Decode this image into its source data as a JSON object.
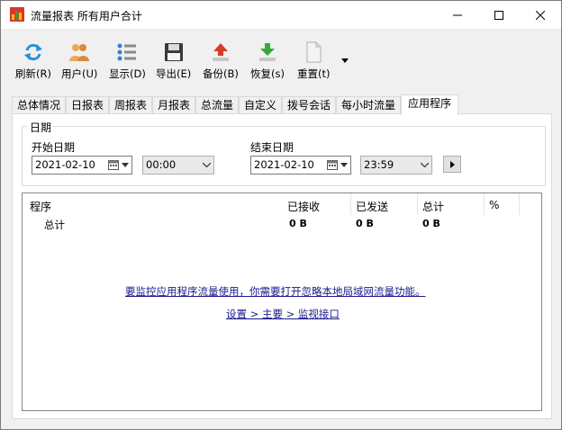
{
  "window": {
    "title": "流量报表 所有用户合计"
  },
  "toolbar": {
    "buttons": [
      {
        "label": "刷新(R)",
        "icon": "refresh-icon"
      },
      {
        "label": "用户(U)",
        "icon": "users-icon"
      },
      {
        "label": "显示(D)",
        "icon": "display-icon"
      },
      {
        "label": "导出(E)",
        "icon": "save-icon"
      },
      {
        "label": "备份(B)",
        "icon": "backup-icon"
      },
      {
        "label": "恢复(s)",
        "icon": "restore-icon"
      },
      {
        "label": "重置(t)",
        "icon": "reset-icon"
      }
    ]
  },
  "tabs": [
    {
      "label": "总体情况",
      "active": false
    },
    {
      "label": "日报表",
      "active": false
    },
    {
      "label": "周报表",
      "active": false
    },
    {
      "label": "月报表",
      "active": false
    },
    {
      "label": "总流量",
      "active": false
    },
    {
      "label": "自定义",
      "active": false
    },
    {
      "label": "拨号会话",
      "active": false
    },
    {
      "label": "每小时流量",
      "active": false
    },
    {
      "label": "应用程序",
      "active": true
    }
  ],
  "date_group": {
    "title": "日期",
    "start_label": "开始日期",
    "start_date": "2021-02-10",
    "start_time": "00:00",
    "end_label": "结束日期",
    "end_date": "2021-02-10",
    "end_time": "23:59"
  },
  "table": {
    "columns": [
      "程序",
      "已接收",
      "已发送",
      "总计",
      "%"
    ],
    "rows": [
      {
        "program": "总计",
        "received": "0 B",
        "sent": "0 B",
        "total": "0 B",
        "percent": ""
      }
    ]
  },
  "notice": {
    "message": "要监控应用程序流量使用，你需要打开忽略本地局域网流量功能。",
    "path": "设置 > 主要 > 监视接口"
  },
  "colors": {
    "link": "#1a1a8c",
    "refresh": "#2a8fd8",
    "backup_arrow": "#d83a2a",
    "restore_arrow": "#3aa83a"
  }
}
